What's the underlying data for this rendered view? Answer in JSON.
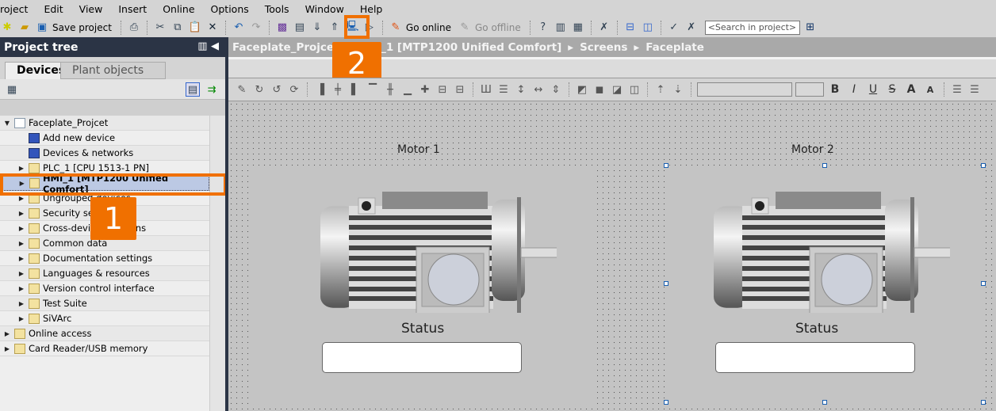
{
  "menu": [
    "roject",
    "Edit",
    "View",
    "Insert",
    "Online",
    "Options",
    "Tools",
    "Window",
    "Help"
  ],
  "toolbar": {
    "save_label": "Save project",
    "go_online": "Go online",
    "go_offline": "Go offline",
    "search_placeholder": "<Search in project>"
  },
  "project_tree": {
    "title": "Project tree",
    "tabs": [
      "Devices",
      "Plant objects"
    ],
    "items": [
      {
        "label": "Faceplate_Projcet",
        "level": 0,
        "expanded": true
      },
      {
        "label": "Add new device",
        "level": 1
      },
      {
        "label": "Devices & networks",
        "level": 1
      },
      {
        "label": "PLC_1 [CPU 1513-1 PN]",
        "level": 1,
        "expandable": true
      },
      {
        "label": "HMI_1 [MTP1200 Unified Comfort]",
        "level": 1,
        "expandable": true,
        "selected": true
      },
      {
        "label": "Ungrouped devices",
        "level": 1,
        "expandable": true
      },
      {
        "label": "Security settings",
        "level": 1,
        "expandable": true
      },
      {
        "label": "Cross-device functions",
        "level": 1,
        "expandable": true
      },
      {
        "label": "Common data",
        "level": 1,
        "expandable": true
      },
      {
        "label": "Documentation settings",
        "level": 1,
        "expandable": true
      },
      {
        "label": "Languages & resources",
        "level": 1,
        "expandable": true
      },
      {
        "label": "Version control interface",
        "level": 1,
        "expandable": true
      },
      {
        "label": "Test Suite",
        "level": 1,
        "expandable": true
      },
      {
        "label": "SiVArc",
        "level": 1,
        "expandable": true
      },
      {
        "label": "Online access",
        "level": 0,
        "expandable": true
      },
      {
        "label": "Card Reader/USB memory",
        "level": 0,
        "expandable": true
      }
    ]
  },
  "breadcrumb": [
    "Faceplate_Projcet",
    "HMI_1 [MTP1200 Unified Comfort]",
    "Screens",
    "Faceplate"
  ],
  "annotations": {
    "step1": "1",
    "step2": "2",
    "color": "#f07000"
  },
  "canvas": {
    "motors": [
      {
        "title": "Motor 1",
        "status_label": "Status"
      },
      {
        "title": "Motor 2",
        "status_label": "Status"
      }
    ]
  }
}
